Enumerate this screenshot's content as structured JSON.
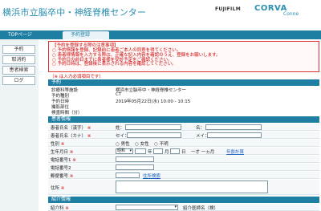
{
  "header": {
    "title": "横浜市立脳卒中・神経脊椎センター",
    "logo_brand": "FUJIFILM",
    "logo_product": "CORVA",
    "logo_sub": "Conne"
  },
  "tabs": {
    "home": "TOPページ",
    "active": "予約登録"
  },
  "sidebar": {
    "items": [
      "予約",
      "取消約",
      "患者検索",
      "ログ"
    ]
  },
  "notice": {
    "heading": "【予約を登録する際の注意事項】",
    "items": [
      "予約情報を登録、記録前に患者ご本人の同意を得てください。",
      "患者様情報を入力する際は、正確な記入内容を確認のうえ、登録をお願いします。",
      "予約日の前日までに患者様を受診予定をご確認ください。",
      "予約日時は、登録後に表示される内容を確認してください。"
    ]
  },
  "req_note": "（※ は入力必須項目です）",
  "sections": {
    "reservation": "予約",
    "patient": "患者情報",
    "referral": "紹介情報"
  },
  "reservation": {
    "rows": [
      {
        "label": "診療科等施設",
        "value": "横浜市立脳卒中・神経脊椎センター"
      },
      {
        "label": "予約種別",
        "value": "CT"
      },
      {
        "label": "予約日時",
        "value": "2019年05月22日(水) 10:00 - 10:15"
      },
      {
        "label": "撮影部位",
        "value": ""
      },
      {
        "label": "検査時間（分）",
        "value": ""
      }
    ]
  },
  "patient": {
    "name_label": "患者氏名（漢字）",
    "name_sei": "姓：",
    "name_mei": "名：",
    "kana_label": "患者氏名（カナ）",
    "kana_sei": "セイ：",
    "kana_mei": "メイ：",
    "sex_label": "性別",
    "sex_options": [
      "男性",
      "女性",
      "不明"
    ],
    "birth_label": "生年月日",
    "birth_era": "昭和",
    "birth_year_suffix": "年",
    "birth_month_suffix": "月",
    "birth_day_suffix": "日",
    "age_text": "一才 一ヵ月",
    "age_link": "年齢計算",
    "phone1_label": "電話番号1",
    "phone2_label": "電話番号2",
    "postal_label": "郵便番号",
    "postal_link": "住所検索",
    "address_label": "住所"
  },
  "referral": {
    "dept_label": "紹介科",
    "doctor_label": "紹介医師名（検）"
  },
  "colors": {
    "accent": "#1f7fa3",
    "title": "#2a8fb0",
    "warning": "#cc0000"
  },
  "required_mark": "※"
}
